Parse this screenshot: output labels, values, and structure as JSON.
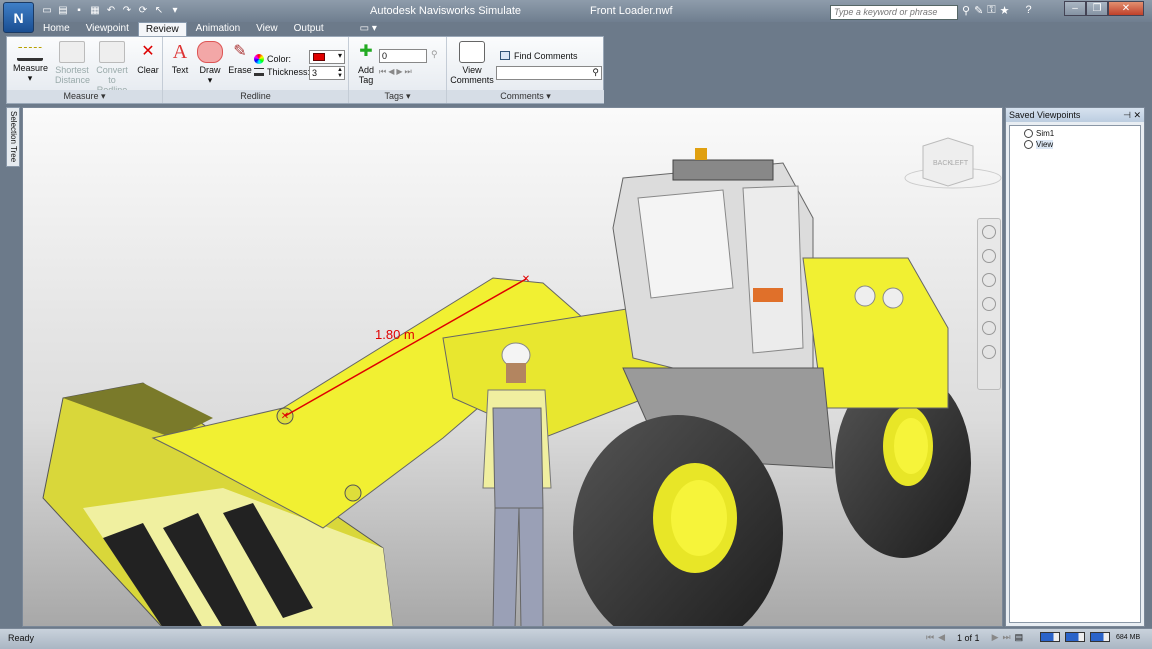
{
  "app": {
    "title": "Autodesk Navisworks Simulate",
    "file": "Front Loader.nwf",
    "app_button_glyph": "N",
    "search_placeholder": "Type a keyword or phrase"
  },
  "tabs": [
    {
      "label": "Home",
      "active": false
    },
    {
      "label": "Viewpoint",
      "active": false
    },
    {
      "label": "Review",
      "active": true
    },
    {
      "label": "Animation",
      "active": false
    },
    {
      "label": "View",
      "active": false
    },
    {
      "label": "Output",
      "active": false
    }
  ],
  "ribbon": {
    "measure": {
      "panel_label": "Measure",
      "measure": "Measure",
      "shortest_1": "Shortest",
      "shortest_2": "Distance",
      "convert_1": "Convert",
      "convert_2": "to Redline",
      "clear": "Clear"
    },
    "redline": {
      "panel_label": "Redline",
      "text": "Text",
      "draw": "Draw",
      "erase": "Erase",
      "color_label": "Color:",
      "thickness_label": "Thickness:",
      "thickness_value": "3",
      "color_value": "#e00000"
    },
    "tags": {
      "panel_label": "Tags",
      "add_1": "Add",
      "add_2": "Tag",
      "tag_value": "0"
    },
    "comments": {
      "panel_label": "Comments",
      "view_1": "View",
      "view_2": "Comments",
      "find": "Find Comments"
    }
  },
  "sidebar_tab": "Selection Tree",
  "saved_viewpoints": {
    "title": "Saved Viewpoints",
    "items": [
      "Sim1",
      "View"
    ]
  },
  "viewport": {
    "measurement_label": "1.80 m",
    "viewcube_back": "BACK",
    "viewcube_left": "LEFT",
    "accent": "#e00000",
    "loader_yellow": "#f1f032"
  },
  "status": {
    "text": "Ready",
    "page": "1 of 1",
    "memory": "684 MB"
  }
}
